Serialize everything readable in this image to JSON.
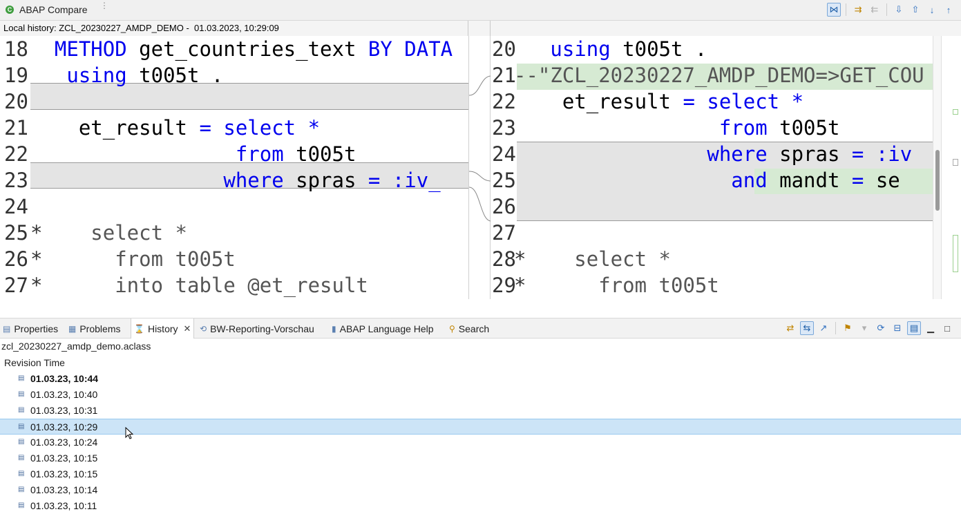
{
  "window": {
    "title": "ABAP Compare",
    "grip": "⋮",
    "toolbar": [
      {
        "name": "compare-mode-icon",
        "glyph": "⋈",
        "active": true
      },
      {
        "name": "copy-left-to-right-icon",
        "glyph": "⇉"
      },
      {
        "name": "copy-right-to-left-icon",
        "glyph": "⇇",
        "disabled": true
      },
      {
        "name": "next-difference-icon",
        "glyph": "⇩"
      },
      {
        "name": "previous-difference-icon",
        "glyph": "⇧"
      },
      {
        "name": "next-change-icon",
        "glyph": "↓"
      },
      {
        "name": "previous-change-icon",
        "glyph": "↑"
      }
    ]
  },
  "compare": {
    "left_header": "Local history: ZCL_20230227_AMDP_DEMO -  01.03.2023, 10:29:09",
    "left_lines": [
      {
        "num": "18",
        "parts": [
          {
            "t": "  "
          },
          {
            "t": "METHOD",
            "c": "kw"
          },
          {
            "t": " get_countries_text "
          },
          {
            "t": "BY DATA",
            "c": "kw"
          }
        ]
      },
      {
        "num": "19",
        "parts": [
          {
            "t": "   "
          },
          {
            "t": "using",
            "c": "kw"
          },
          {
            "t": " t005t ."
          }
        ]
      },
      {
        "num": "20",
        "parts": []
      },
      {
        "num": "21",
        "parts": [
          {
            "t": "    et_result "
          },
          {
            "t": "=",
            "c": "kw"
          },
          {
            "t": " "
          },
          {
            "t": "select",
            "c": "kw"
          },
          {
            "t": " "
          },
          {
            "t": "*",
            "c": "kw"
          }
        ]
      },
      {
        "num": "22",
        "parts": [
          {
            "t": "                 "
          },
          {
            "t": "from",
            "c": "kw"
          },
          {
            "t": " t005t"
          }
        ]
      },
      {
        "num": "23",
        "parts": [
          {
            "t": "                "
          },
          {
            "t": "where",
            "c": "kw"
          },
          {
            "t": " spras "
          },
          {
            "t": "=",
            "c": "kw"
          },
          {
            "t": " "
          },
          {
            "t": ":iv_",
            "c": "kw"
          }
        ]
      },
      {
        "num": "24",
        "parts": []
      },
      {
        "num": "25",
        "parts": [
          {
            "t": "*",
            "c": "star"
          },
          {
            "t": "    select *",
            "c": "cm"
          }
        ]
      },
      {
        "num": "26",
        "parts": [
          {
            "t": "*",
            "c": "star"
          },
          {
            "t": "      from t005t",
            "c": "cm"
          }
        ]
      },
      {
        "num": "27",
        "parts": [
          {
            "t": "*",
            "c": "star"
          },
          {
            "t": "      into table @et_result",
            "c": "cm"
          }
        ]
      }
    ],
    "right_lines": [
      {
        "num": "20",
        "parts": [
          {
            "t": "   "
          },
          {
            "t": "using",
            "c": "kw"
          },
          {
            "t": " t005t ."
          }
        ]
      },
      {
        "num": "21",
        "parts": [
          {
            "t": "--\"ZCL_20230227_AMDP_DEMO=>GET_COU",
            "c": "cm"
          }
        ]
      },
      {
        "num": "22",
        "parts": [
          {
            "t": "    et_result "
          },
          {
            "t": "=",
            "c": "kw"
          },
          {
            "t": " "
          },
          {
            "t": "select",
            "c": "kw"
          },
          {
            "t": " "
          },
          {
            "t": "*",
            "c": "kw"
          }
        ]
      },
      {
        "num": "23",
        "parts": [
          {
            "t": "                 "
          },
          {
            "t": "from",
            "c": "kw"
          },
          {
            "t": " t005t"
          }
        ]
      },
      {
        "num": "24",
        "parts": [
          {
            "t": "                "
          },
          {
            "t": "where",
            "c": "kw"
          },
          {
            "t": " spras "
          },
          {
            "t": "=",
            "c": "kw"
          },
          {
            "t": " "
          },
          {
            "t": ":iv",
            "c": "kw"
          }
        ]
      },
      {
        "num": "25",
        "parts": [
          {
            "t": "                  "
          },
          {
            "t": "and",
            "c": "kw"
          },
          {
            "t": " mandt "
          },
          {
            "t": "=",
            "c": "kw"
          },
          {
            "t": " se"
          }
        ]
      },
      {
        "num": "26",
        "parts": []
      },
      {
        "num": "27",
        "parts": []
      },
      {
        "num": "28",
        "parts": [
          {
            "t": "*",
            "c": "star"
          },
          {
            "t": "    select *",
            "c": "cm"
          }
        ]
      },
      {
        "num": "29",
        "parts": [
          {
            "t": "*",
            "c": "star"
          },
          {
            "t": "      from t005t",
            "c": "cm"
          }
        ]
      }
    ]
  },
  "tabs": {
    "properties": "Properties",
    "problems": "Problems",
    "history": "History",
    "history_close": "✕",
    "bw_preview": "BW-Reporting-Vorschau",
    "abap_help": "ABAP Language Help",
    "search": "Search"
  },
  "history": {
    "path": "zcl_20230227_amdp_demo.aclass",
    "column_header": "Revision Time",
    "rows": [
      {
        "time": "01.03.23, 10:44",
        "bold": true
      },
      {
        "time": "01.03.23, 10:40"
      },
      {
        "time": "01.03.23, 10:31"
      },
      {
        "time": "01.03.23, 10:29",
        "selected": true
      },
      {
        "time": "01.03.23, 10:24"
      },
      {
        "time": "01.03.23, 10:15"
      },
      {
        "time": "01.03.23, 10:15"
      },
      {
        "time": "01.03.23, 10:14"
      },
      {
        "time": "01.03.23, 10:11"
      }
    ]
  },
  "colors": {
    "keyword": "#0000ee",
    "comment": "#555555",
    "diff_grey": "#e4e4e4",
    "diff_green": "#d6ead3",
    "selection": "#cce4f7"
  }
}
